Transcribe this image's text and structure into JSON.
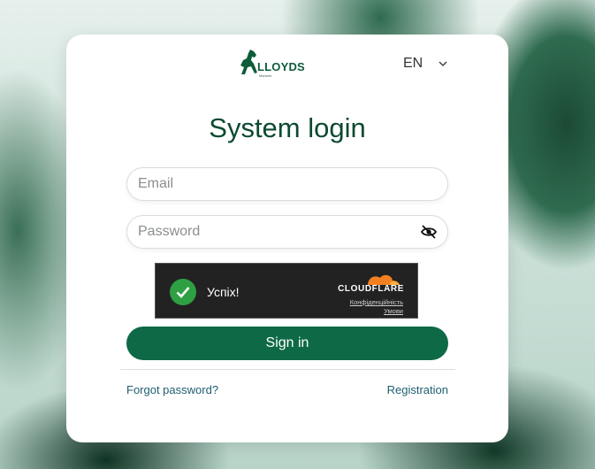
{
  "header": {
    "logo_text": "LLOYDS",
    "logo_sub": "Markets",
    "language": "EN"
  },
  "login": {
    "title": "System login",
    "email_placeholder": "Email",
    "password_placeholder": "Password",
    "sign_in_label": "Sign in",
    "forgot_label": "Forgot password?",
    "register_label": "Registration"
  },
  "captcha": {
    "status_text": "Успіх!",
    "brand": "CLOUDFLARE",
    "privacy_link": "Конфіденційність",
    "terms_link": "Умови"
  },
  "colors": {
    "accent": "#0e6a46",
    "title": "#0d4a31",
    "link": "#1e5e72",
    "success": "#2ea043",
    "cloudflare": "#f38020"
  },
  "icons": [
    "horse-logo-icon",
    "chevron-down-icon",
    "eye-off-icon",
    "check-icon",
    "cloud-icon"
  ]
}
